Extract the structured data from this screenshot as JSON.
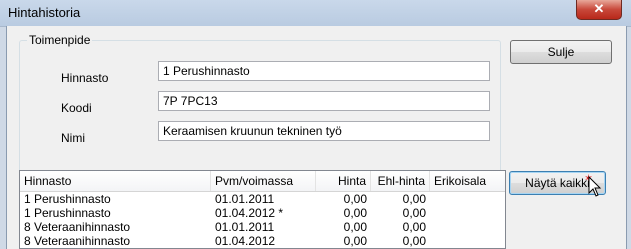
{
  "window": {
    "title": "Hintahistoria",
    "close_glyph": "✕"
  },
  "group": {
    "legend": "Toimenpide",
    "fields": [
      {
        "label": "Hinnasto",
        "value": "1 Perushinnasto"
      },
      {
        "label": "Koodi",
        "value": "7P 7PC13"
      },
      {
        "label": "Nimi",
        "value": "Keraamisen kruunun tekninen työ"
      }
    ]
  },
  "buttons": {
    "close_label": "Sulje",
    "show_all_label": "Näytä kaikki"
  },
  "table": {
    "columns": [
      "Hinnasto",
      "Pvm/voimassa",
      "Hinta",
      "Ehl-hinta",
      "Erikoisala"
    ],
    "rows": [
      [
        "1  Perushinnasto",
        "01.01.2011",
        "0,00",
        "0,00",
        ""
      ],
      [
        "1  Perushinnasto",
        "01.04.2012 *",
        "0,00",
        "0,00",
        ""
      ],
      [
        "8  Veteraanihinnasto",
        "01.01.2011",
        "0,00",
        "0,00",
        ""
      ],
      [
        "8  Veteraanihinnasto",
        "01.04.2012",
        "0,00",
        "0,00",
        ""
      ]
    ]
  },
  "colors": {
    "accent": "#3c7fb1",
    "close": "#c8483a"
  },
  "icons": [
    "close-icon",
    "mouse-cursor-icon"
  ]
}
